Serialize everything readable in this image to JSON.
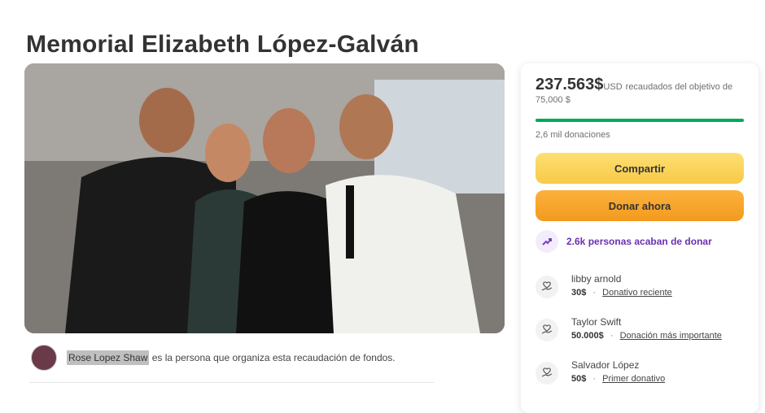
{
  "page_title": "Memorial Elizabeth López-Galván",
  "photo": {
    "name": "family-photo"
  },
  "organizer": {
    "name": "Rose Lopez Shaw",
    "text": "es la persona que organiza esta recaudación de fondos."
  },
  "fundraiser": {
    "raised_amount": "237.563$",
    "currency": "USD",
    "goal_text": "recaudados del objetivo de 75,000 $",
    "progress_fraction": 1.0,
    "donations_count": "2,6 mil donaciones",
    "share_label": "Compartir",
    "donate_label": "Donar ahora",
    "recent_donate_text": "2.6k personas acaban de donar"
  },
  "donors": [
    {
      "name": "libby arnold",
      "amount": "30$",
      "tag": "Donativo reciente"
    },
    {
      "name": "Taylor Swift",
      "amount": "50.000$",
      "tag": "Donación más importante"
    },
    {
      "name": "Salvador López",
      "amount": "50$",
      "tag": "Primer donativo"
    }
  ],
  "colors": {
    "progress": "#02a95c",
    "share_button": "#f7c948",
    "donate_button": "#f39a1f",
    "accent_purple": "#6b2fb2"
  },
  "icons": {
    "trend": "trend-up-icon",
    "donor": "hand-heart-icon"
  }
}
